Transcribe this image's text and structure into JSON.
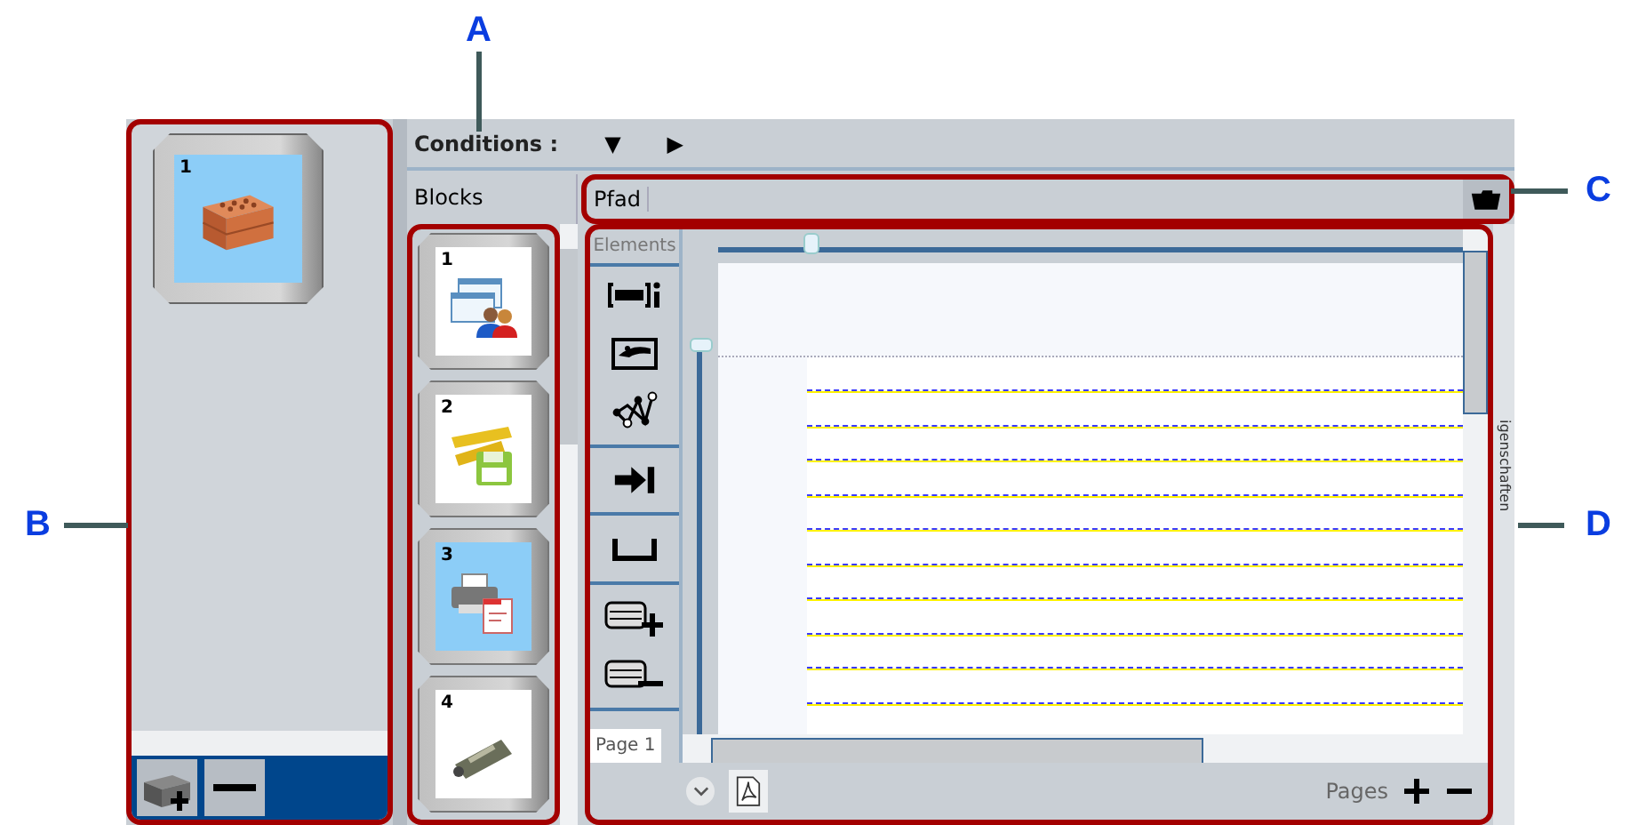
{
  "callouts": [
    {
      "label": "A",
      "kind": "top"
    },
    {
      "label": "B",
      "kind": "left"
    },
    {
      "label": "C",
      "kind": "right-top"
    },
    {
      "label": "D",
      "kind": "right"
    }
  ],
  "workspace": {
    "block": {
      "number": "1",
      "kind": "brick",
      "selected": true
    }
  },
  "conditions": {
    "label": "Conditions :",
    "buttons": [
      "▼",
      "▶"
    ]
  },
  "blocks": {
    "header": "Blocks",
    "items": [
      {
        "number": "1",
        "kind": "windows-users",
        "selected": false
      },
      {
        "number": "2",
        "kind": "ruler-save",
        "selected": false
      },
      {
        "number": "3",
        "kind": "printer-document",
        "selected": true
      },
      {
        "number": "4",
        "kind": "sensor",
        "selected": false
      }
    ]
  },
  "path": {
    "label": "Pfad"
  },
  "elements": {
    "header": "Elements"
  },
  "side_tab": "igenschaften",
  "footer": {
    "page": "Page 1",
    "pages_label": "Pages"
  }
}
